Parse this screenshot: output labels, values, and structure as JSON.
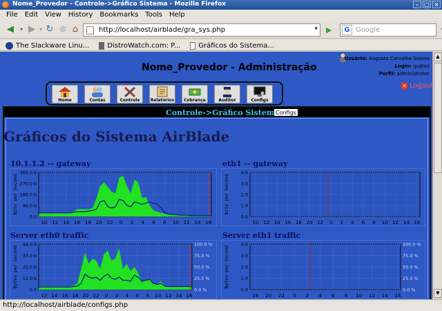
{
  "window": {
    "title": "Nome_Provedor - Controle->Gráfico Sistema - Mozilla Firefox"
  },
  "menu": [
    "File",
    "Edit",
    "View",
    "History",
    "Bookmarks",
    "Tools",
    "Help"
  ],
  "nav": {
    "url": "http://localhost/airblade/gra_sys.php",
    "search_placeholder": "Google",
    "search_engine_letter": "G"
  },
  "bookmarks": [
    "The Slackware Linu...",
    "DistroWatch.com: P...",
    "Gráficos do Sistema..."
  ],
  "status": "http://localhost/airblade/configs.php",
  "page": {
    "title": "Nome_Provedor - Administração",
    "user": {
      "user_label": "Usuário:",
      "user_name": "Augusto Carvalho Soares",
      "login_label": "Login:",
      "login": "gustao",
      "profile_label": "Perfil:",
      "profile": "administrator"
    },
    "logout": "Logout",
    "buttons": [
      "Home",
      "Contas",
      "Controle",
      "Relatórios",
      "Cobrança",
      "Auditor",
      "Configs"
    ],
    "breadcrumb": "Controle->Gráfico Sistema",
    "breadcrumb_button": "Configs",
    "heading": "Gráficos do Sistema AirBlade"
  },
  "chart_data": [
    {
      "type": "area",
      "title": "10.1.1.2 -- gateway",
      "ylabel": "Bits per Second",
      "ylim": [
        0,
        360000
      ],
      "yticks": [
        "0.0",
        "90.0 k",
        "180.0 k",
        "270.0 k",
        "360.0 k"
      ],
      "xticks": [
        "10",
        "12",
        "14",
        "16",
        "18",
        "20",
        "22",
        "0",
        "2",
        "4",
        "6",
        "8",
        "10",
        "12",
        "14",
        "16"
      ],
      "series": [
        {
          "values": [
            30000,
            30000,
            30000,
            30000,
            30000,
            30000,
            30000,
            30000,
            30000,
            40000,
            60000,
            60000,
            60000,
            60000,
            70000,
            150000,
            250000,
            280000,
            240000,
            200000,
            190000,
            320000,
            330000,
            250000,
            190000,
            300000,
            280000,
            150000,
            160000,
            90000,
            50000,
            40000,
            30000,
            20000,
            15000,
            20000,
            10000,
            10000,
            8000,
            8000,
            5000,
            5000,
            5000,
            5000,
            5000,
            5000
          ]
        },
        {
          "values": [
            30000,
            30000,
            30000,
            30000,
            30000,
            30000,
            30000,
            30000,
            30000,
            35000,
            40000,
            40000,
            40000,
            45000,
            50000,
            60000,
            120000,
            130000,
            80000,
            70000,
            80000,
            140000,
            130000,
            90000,
            80000,
            120000,
            110000,
            100000,
            110000,
            120000,
            110000,
            100000,
            70000,
            30000,
            20000,
            15000,
            15000,
            10000,
            10000,
            10000,
            8000,
            8000,
            8000,
            8000,
            8000,
            8000
          ]
        }
      ]
    },
    {
      "type": "area",
      "title": "eth1 -- gateway",
      "ylabel": "Bits per Second",
      "ylim": [
        0,
        4
      ],
      "yticks": [
        "0.0",
        "1.0",
        "2.0",
        "3.0",
        "4.0"
      ],
      "xticks": [
        "10",
        "12",
        "14",
        "16",
        "18",
        "20",
        "22",
        "0",
        "2",
        "4",
        "6",
        "8",
        "10",
        "12",
        "14",
        "16"
      ],
      "series": []
    },
    {
      "type": "area",
      "title": "Server eth0 traffic",
      "ylabel": "Bytes per Second",
      "ylim": [
        0,
        44000
      ],
      "yticks": [
        "0.0",
        "11.0 k",
        "22.0 k",
        "33.0 k",
        "44.0 k"
      ],
      "y2ticks": [
        "0.0 %",
        "25.0 %",
        "50.0 %",
        "75.0 %",
        "100.0 %"
      ],
      "xticks": [
        "12",
        "14",
        "16",
        "18",
        "20",
        "22",
        "0",
        "2",
        "4",
        "6",
        "8",
        "10",
        "12",
        "14",
        "16"
      ],
      "series": [
        {
          "values": [
            3000,
            3000,
            3000,
            3000,
            3000,
            3000,
            3000,
            3000,
            3000,
            4000,
            6000,
            20000,
            36000,
            25000,
            30000,
            28000,
            20000,
            34000,
            38000,
            28000,
            30000,
            40000,
            20000,
            25000,
            18000,
            22000,
            16000,
            8000,
            9000,
            10000,
            6000,
            5000,
            8000,
            4000,
            3000,
            3000,
            3000,
            3000,
            3000,
            3000,
            3000
          ]
        },
        {
          "values": [
            2500,
            2500,
            2500,
            2500,
            2500,
            2500,
            2500,
            2500,
            2500,
            3000,
            3500,
            6000,
            15000,
            12000,
            11000,
            12000,
            9000,
            13000,
            15000,
            11000,
            10000,
            12000,
            9000,
            9000,
            8000,
            14000,
            12000,
            8000,
            9000,
            10000,
            6000,
            5000,
            6000,
            3500,
            3000,
            3000,
            3000,
            3000,
            3000,
            3000,
            3000
          ]
        }
      ]
    },
    {
      "type": "area",
      "title": "Server eth1 traffic",
      "ylabel": "Bytes per Second",
      "ylim": [
        0,
        4
      ],
      "yticks": [
        "0.0",
        "1.0",
        "2.0",
        "3.0",
        "4.0"
      ],
      "y2ticks": [
        "0.0 %",
        "25.0 %",
        "50.0 %",
        "75.0 %",
        "100.0 %"
      ],
      "xticks": [
        "18",
        "20",
        "22",
        "0",
        "2",
        "4",
        "6",
        "8",
        "10",
        "12",
        "14",
        "16"
      ],
      "series": []
    }
  ]
}
